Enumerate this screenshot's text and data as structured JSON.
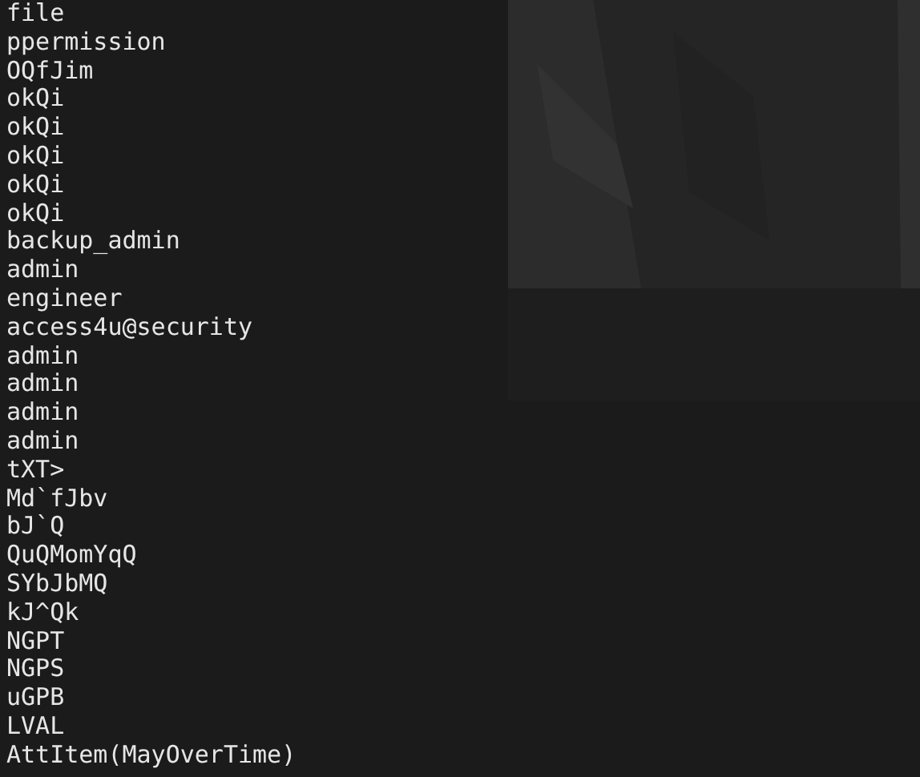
{
  "terminal": {
    "lines": [
      "file",
      "ppermission",
      "OQfJim",
      "okQi",
      "okQi",
      "okQi",
      "okQi",
      "okQi",
      "backup_admin",
      "admin",
      "engineer",
      "access4u@security",
      "admin",
      "admin",
      "admin",
      "admin",
      "tXT>",
      "Md`fJbv",
      "bJ`Q",
      "QuQMomYqQ",
      "SYbJbMQ",
      "kJ^Qk",
      "NGPT",
      "NGPS",
      "uGPB",
      "LVAL",
      "AttItem(MayOverTime)"
    ]
  }
}
